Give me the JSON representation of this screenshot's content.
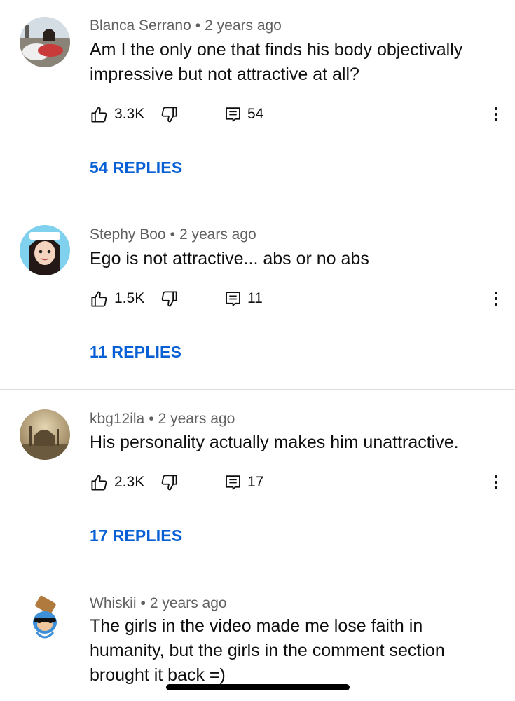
{
  "comments": [
    {
      "author": "Blanca Serrano",
      "separator": "•",
      "time": "2 years ago",
      "text": "Am I the only one that finds his body objectivally impressive but not attractive at all?",
      "likes": "3.3K",
      "reply_count": "54",
      "replies_label": "54 REPLIES"
    },
    {
      "author": "Stephy Boo",
      "separator": "•",
      "time": "2 years ago",
      "text": "Ego is not attractive... abs or no abs",
      "likes": "1.5K",
      "reply_count": "11",
      "replies_label": "11 REPLIES"
    },
    {
      "author": "kbg12ila",
      "separator": "•",
      "time": "2 years ago",
      "text": "His personality actually makes him unattractive.",
      "likes": "2.3K",
      "reply_count": "17",
      "replies_label": "17 REPLIES"
    },
    {
      "author": "Whiskii",
      "separator": "•",
      "time": "2 years ago",
      "text": "The girls in the video made me lose faith in humanity, but the girls in the comment section brought it back =)"
    }
  ],
  "icons": {
    "like": "thumbs-up-icon",
    "dislike": "thumbs-down-icon",
    "reply": "comment-icon",
    "more": "more-vertical-icon"
  },
  "colors": {
    "replies_link": "#065fd4",
    "meta_text": "#606060",
    "body_text": "#0f0f0f",
    "divider": "#dcdcdc"
  }
}
